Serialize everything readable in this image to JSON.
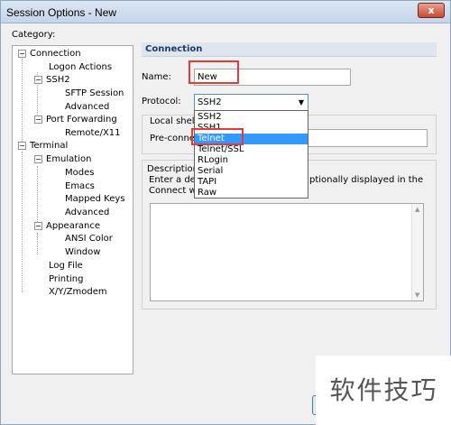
{
  "window": {
    "title": "Session Options - New",
    "close_glyph": "x"
  },
  "category": {
    "label": "Category:",
    "tree": [
      {
        "label": "Connection",
        "expander": "−"
      },
      {
        "label": "Logon Actions"
      },
      {
        "label": "SSH2",
        "expander": "−"
      },
      {
        "label": "SFTP Session"
      },
      {
        "label": "Advanced"
      },
      {
        "label": "Port Forwarding",
        "expander": "−"
      },
      {
        "label": "Remote/X11"
      },
      {
        "label": "Terminal",
        "expander": "−"
      },
      {
        "label": "Emulation",
        "expander": "−"
      },
      {
        "label": "Modes"
      },
      {
        "label": "Emacs"
      },
      {
        "label": "Mapped Keys"
      },
      {
        "label": "Advanced"
      },
      {
        "label": "Appearance",
        "expander": "−"
      },
      {
        "label": "ANSI Color"
      },
      {
        "label": "Window"
      },
      {
        "label": "Log File"
      },
      {
        "label": "Printing"
      },
      {
        "label": "X/Y/Zmodem"
      }
    ]
  },
  "panel": {
    "header": "Connection",
    "name_label": "Name:",
    "name_value": "New",
    "protocol_label": "Protocol:",
    "protocol_value": "SSH2",
    "protocol_arrow": "▼",
    "protocol_options": [
      "SSH2",
      "SSH1",
      "Telnet",
      "Telnet/SSL",
      "RLogin",
      "Serial",
      "TAPI",
      "Raw"
    ],
    "highlighted_option": "Telnet",
    "local_shell_label": "Local shell c",
    "preconnect_label": "Pre-conne",
    "description_title": "Description",
    "description_line1a": "Enter a des",
    "description_line1b": "ptionally displayed in the",
    "description_line2": "Connect wi",
    "scroll_up": "▲",
    "scroll_down": "▼"
  },
  "watermark": "软件技巧",
  "colors": {
    "highlight": "#3399ff",
    "annotation_red": "#e23b3b"
  }
}
